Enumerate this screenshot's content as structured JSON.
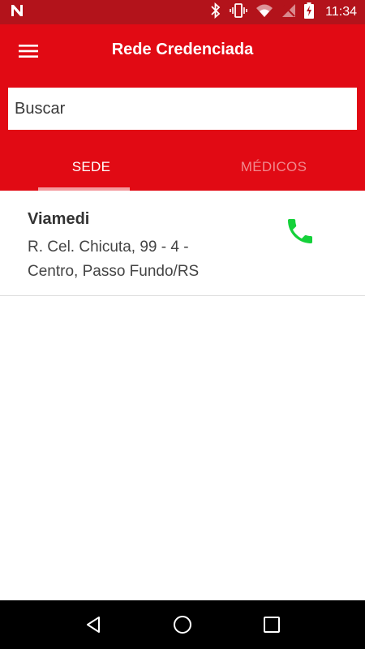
{
  "status_bar": {
    "time": "11:34",
    "icons": [
      "n-notification-icon",
      "bluetooth-icon",
      "vibrate-icon",
      "wifi-icon",
      "no-signal-icon",
      "battery-charging-icon"
    ]
  },
  "app_bar": {
    "title": "Rede Credenciada",
    "menu_icon": "hamburger-menu-icon",
    "background_color": "#e10a14"
  },
  "search": {
    "placeholder": "Buscar",
    "value": ""
  },
  "tabs": [
    {
      "label": "SEDE",
      "active": true
    },
    {
      "label": "MÉDICOS",
      "active": false
    }
  ],
  "list": {
    "items": [
      {
        "name": "Viamedi",
        "address": "R. Cel. Chicuta, 99 - 4 - Centro, Passo Fundo/RS",
        "action_icon": "phone-icon",
        "action_color": "#15d13a"
      }
    ]
  },
  "nav_bar": {
    "buttons": [
      "back-icon",
      "home-icon",
      "recents-icon"
    ]
  }
}
